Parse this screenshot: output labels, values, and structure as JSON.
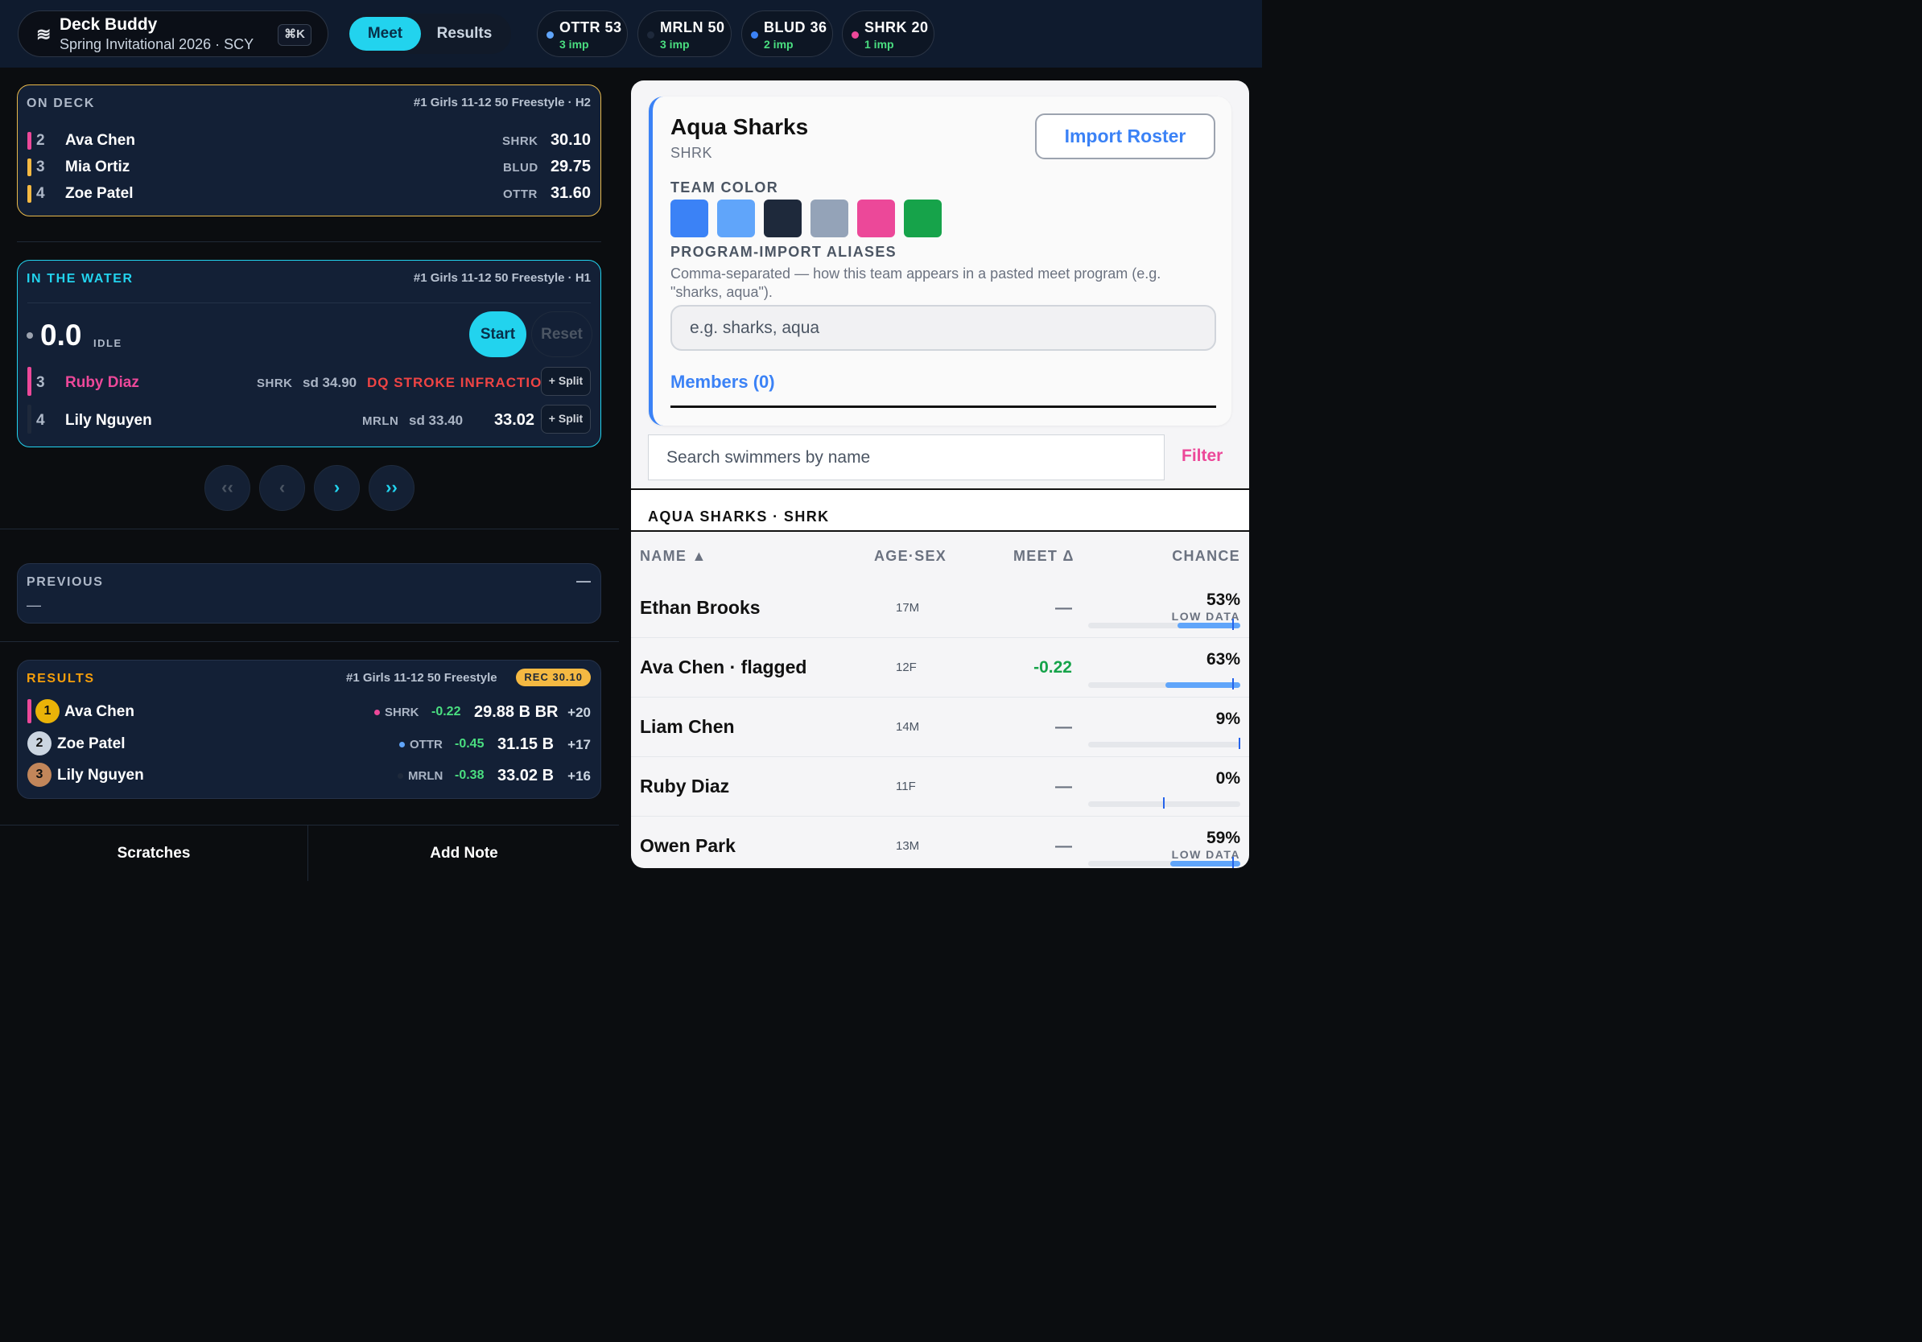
{
  "header": {
    "wave_icon": "≋",
    "app_title": "Deck Buddy",
    "meet_subtitle": "Spring Invitational 2026 · SCY",
    "shortcut": "⌘K",
    "nav": {
      "meet": "Meet",
      "results": "Results"
    },
    "teams": [
      {
        "code": "OTTR 53",
        "imp": "3 imp",
        "color": "#60a5fa"
      },
      {
        "code": "MRLN 50",
        "imp": "3 imp",
        "color": "#1e293b"
      },
      {
        "code": "BLUD 36",
        "imp": "2 imp",
        "color": "#3b82f6"
      },
      {
        "code": "SHRK 20",
        "imp": "1 imp",
        "color": "#ec4899"
      }
    ]
  },
  "on_deck": {
    "label": "ON DECK",
    "event": "#1 Girls 11-12 50 Freestyle · H2",
    "swimmers": [
      {
        "lane": "2",
        "name": "Ava Chen",
        "team": "SHRK",
        "time": "30.10",
        "color": "#ec4899"
      },
      {
        "lane": "3",
        "name": "Mia Ortiz",
        "team": "BLUD",
        "time": "29.75",
        "color": "#f5b942"
      },
      {
        "lane": "4",
        "name": "Zoe Patel",
        "team": "OTTR",
        "time": "31.60",
        "color": "#f5b942"
      }
    ]
  },
  "in_water": {
    "label": "IN THE WATER",
    "event": "#1 Girls 11-12 50 Freestyle · H1",
    "clock": "0.0",
    "state": "IDLE",
    "start": "Start",
    "reset": "Reset",
    "swimmers": [
      {
        "lane": "3",
        "name": "Ruby Diaz",
        "team": "SHRK",
        "seed": "sd 34.90",
        "status": "DQ STROKE INFRACTION",
        "split": "+ Split"
      },
      {
        "lane": "4",
        "name": "Lily Nguyen",
        "team": "MRLN",
        "seed": "sd 33.40",
        "time": "33.02",
        "split": "+ Split"
      }
    ],
    "nav": {
      "first": "‹‹",
      "prev": "‹",
      "next": "›",
      "last": "››"
    }
  },
  "previous": {
    "label": "PREVIOUS",
    "toggle": "—",
    "content": "—"
  },
  "results": {
    "label": "RESULTS",
    "event": "#1 Girls 11-12 50 Freestyle",
    "record": "REC 30.10",
    "rows": [
      {
        "place": "1",
        "name": "Ava Chen",
        "team": "SHRK",
        "team_color": "#ec4899",
        "delta": "-0.22",
        "time": "29.88 B BR",
        "points": "+20"
      },
      {
        "place": "2",
        "name": "Zoe Patel",
        "team": "OTTR",
        "team_color": "#60a5fa",
        "delta": "-0.45",
        "time": "31.15 B",
        "points": "+17"
      },
      {
        "place": "3",
        "name": "Lily Nguyen",
        "team": "MRLN",
        "team_color": "#1e293b",
        "delta": "-0.38",
        "time": "33.02 B",
        "points": "+16"
      }
    ]
  },
  "footer": {
    "scratches": "Scratches",
    "add_note": "Add Note"
  },
  "team_panel": {
    "name": "Aqua Sharks",
    "code": "SHRK",
    "import_button": "Import Roster",
    "color_label": "TEAM COLOR",
    "colors": [
      "#3b82f6",
      "#60a5fa",
      "#1e293b",
      "#94a3b8",
      "#ec4899",
      "#16a34a"
    ],
    "alias_label": "PROGRAM-IMPORT ALIASES",
    "alias_help": "Comma-separated — how this team appears in a pasted meet program (e.g. \"sharks, aqua\").",
    "alias_placeholder": "e.g. sharks, aqua",
    "members_tab": "Members (0)"
  },
  "roster": {
    "search_placeholder": "Search swimmers by name",
    "filter": "Filter",
    "section_title": "AQUA SHARKS · SHRK",
    "columns": {
      "name": "NAME ▲",
      "age_sex": "AGE·SEX",
      "meet_delta": "MEET Δ",
      "chance": "CHANCE"
    },
    "rows": [
      {
        "name": "Ethan Brooks",
        "age_sex": "17M",
        "delta": "—",
        "chance": "53%",
        "low_data": "LOW DATA",
        "chance_value": 0.53
      },
      {
        "name": "Ava Chen · flagged",
        "age_sex": "12F",
        "delta": "-0.22",
        "chance": "63%",
        "low_data": "",
        "chance_value": 0.63
      },
      {
        "name": "Liam Chen",
        "age_sex": "14M",
        "delta": "—",
        "chance": "9%",
        "low_data": "",
        "chance_value": 0.09
      },
      {
        "name": "Ruby Diaz",
        "age_sex": "11F",
        "delta": "—",
        "chance": "0%",
        "low_data": "",
        "chance_value": 0.0
      },
      {
        "name": "Owen Park",
        "age_sex": "13M",
        "delta": "—",
        "chance": "59%",
        "low_data": "LOW DATA",
        "chance_value": 0.59
      }
    ]
  }
}
